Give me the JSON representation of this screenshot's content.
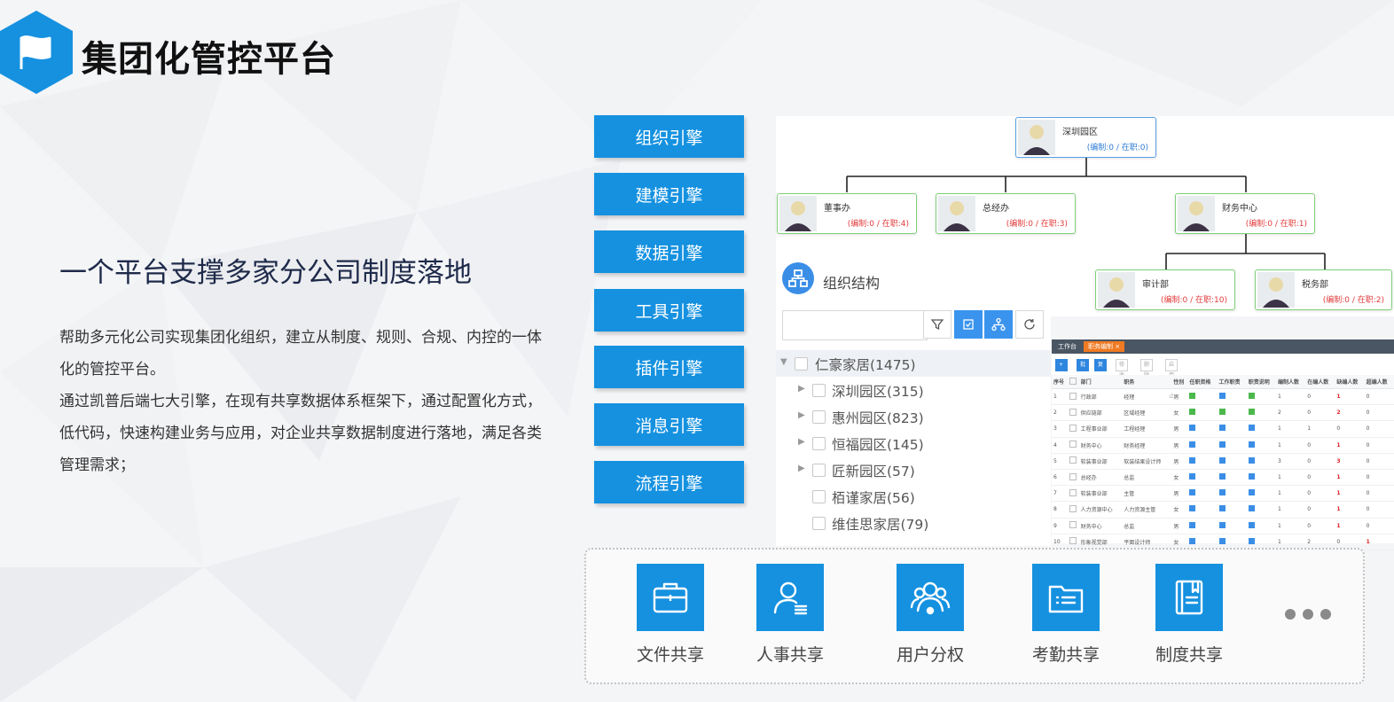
{
  "header": {
    "title": "集团化管控平台",
    "logo_icon": "flag-icon",
    "logo_color": "#1591e0"
  },
  "left": {
    "headline": "一个平台支撑多家分公司制度落地",
    "paragraph1": "帮助多元化公司实现集团化组织，建立从制度、规则、合规、内控的一体化的管控平台。",
    "paragraph2": "通过凯普后端七大引擎，在现有共享数据体系框架下，通过配置化方式，低代码，快速构建业务与应用，对企业共享数据制度进行落地，满足各类管理需求；"
  },
  "engines": [
    "组织引擎",
    "建模引擎",
    "数据引擎",
    "工具引擎",
    "插件引擎",
    "消息引擎",
    "流程引擎"
  ],
  "org_chart": {
    "root": {
      "name": "深圳园区",
      "count": "(编制:0 / 在职:0)"
    },
    "level1": [
      {
        "name": "董事办",
        "count": "(编制:0 / 在职:4)"
      },
      {
        "name": "总经办",
        "count": "(编制:0 / 在职:3)"
      },
      {
        "name": "财务中心",
        "count": "(编制:0 / 在职:1)"
      }
    ],
    "level2": [
      {
        "name": "审计部",
        "count": "(编制:0 / 在职:10)"
      },
      {
        "name": "税务部",
        "count": "(编制:0 / 在职:2)"
      }
    ]
  },
  "tree": {
    "title": "组织结构",
    "header_icon": "org-structure-icon",
    "search_placeholder": "",
    "rows": [
      {
        "label": "仁豪家居(1475)"
      },
      {
        "label": "深圳园区(315)"
      },
      {
        "label": "惠州园区(823)"
      },
      {
        "label": "恒福园区(145)"
      },
      {
        "label": "匠新园区(57)"
      },
      {
        "label": "栢谨家居(56)"
      },
      {
        "label": "维佳思家居(79)"
      }
    ]
  },
  "table_panel": {
    "tabs": [
      "工作台",
      "职务编制 ×"
    ],
    "toolbar": [
      "+ 新增",
      "批量",
      "复制",
      "修改",
      "删除",
      "启用停止"
    ],
    "columns": [
      "序号",
      "",
      "部门",
      "职务",
      "性别",
      "任职资格",
      "工作职责",
      "职责说明",
      "编制人数",
      "在编人数",
      "缺编人数",
      "超编人数"
    ],
    "rows": [
      [
        "1",
        "",
        "行政部",
        "经理",
        "男",
        "g",
        "b",
        "g",
        "1",
        "0",
        "1",
        "0"
      ],
      [
        "2",
        "",
        "供应链部",
        "区域经理",
        "女",
        "g",
        "g",
        "g",
        "2",
        "0",
        "2",
        "0"
      ],
      [
        "3",
        "",
        "工程事业部",
        "工程经理",
        "男",
        "b",
        "b",
        "b",
        "1",
        "1",
        "0",
        "0"
      ],
      [
        "4",
        "",
        "财务中心",
        "财务经理",
        "男",
        "b",
        "b",
        "b",
        "1",
        "0",
        "1",
        "0"
      ],
      [
        "5",
        "",
        "软装事业部",
        "软装结果设计师",
        "男",
        "b",
        "b",
        "b",
        "3",
        "0",
        "3",
        "0"
      ],
      [
        "6",
        "",
        "总经办",
        "总监",
        "女",
        "b",
        "b",
        "b",
        "1",
        "0",
        "1",
        "0"
      ],
      [
        "7",
        "",
        "软装事业部",
        "主管",
        "男",
        "b",
        "b",
        "b",
        "1",
        "0",
        "1",
        "0"
      ],
      [
        "8",
        "",
        "人力资源中心",
        "人力资源主管",
        "女",
        "b",
        "b",
        "b",
        "1",
        "0",
        "1",
        "0"
      ],
      [
        "9",
        "",
        "财务中心",
        "总监",
        "男",
        "b",
        "b",
        "b",
        "1",
        "0",
        "1",
        "0"
      ],
      [
        "10",
        "",
        "形象视觉部",
        "平面设计师",
        "女",
        "b",
        "b",
        "b",
        "1",
        "2",
        "0",
        "1"
      ]
    ]
  },
  "shares": [
    {
      "label": "文件共享",
      "icon": "briefcase-icon"
    },
    {
      "label": "人事共享",
      "icon": "user-card-icon"
    },
    {
      "label": "用户分权",
      "icon": "user-group-icon"
    },
    {
      "label": "考勤共享",
      "icon": "folder-list-icon"
    },
    {
      "label": "制度共享",
      "icon": "book-icon"
    }
  ],
  "more_icon": "more-dots-icon"
}
